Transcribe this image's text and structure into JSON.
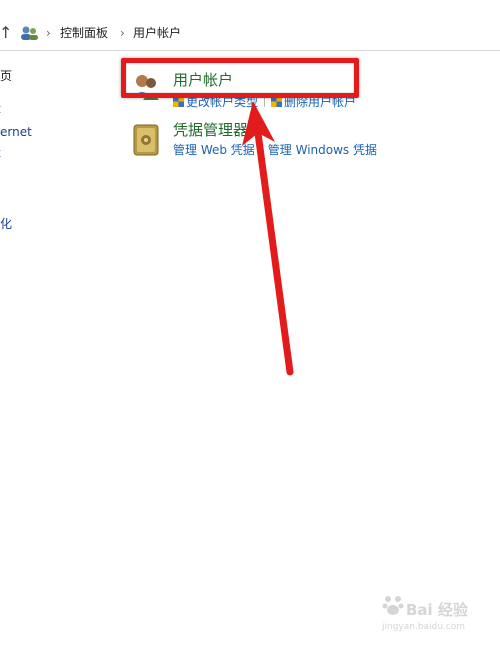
{
  "address_bar": {
    "up_arrow": "↑",
    "icon": "control-panel-icon",
    "chevron": "›",
    "crumbs": [
      "控制面板",
      "用户帐户"
    ]
  },
  "sidebar_fragments": [
    "页",
    "t",
    "ernet",
    "k",
    "化",
    "E"
  ],
  "categories": [
    {
      "title": "用户帐户",
      "icon": "users-icon",
      "tasks": [
        {
          "label": "更改帐户类型",
          "icon": "shield-icon"
        },
        {
          "label": "删除用户帐户",
          "icon": "shield-icon"
        }
      ]
    },
    {
      "title": "凭据管理器",
      "icon": "vault-icon",
      "tasks": [
        {
          "label": "管理 Web 凭据"
        },
        {
          "label": "管理 Windows 凭据"
        }
      ]
    }
  ],
  "annotation": {
    "box_color": "#e31b1b",
    "arrow_color": "#e31b1b"
  },
  "watermark": {
    "line1": "Bai 经验",
    "line2": "jingyan.baidu.com"
  }
}
